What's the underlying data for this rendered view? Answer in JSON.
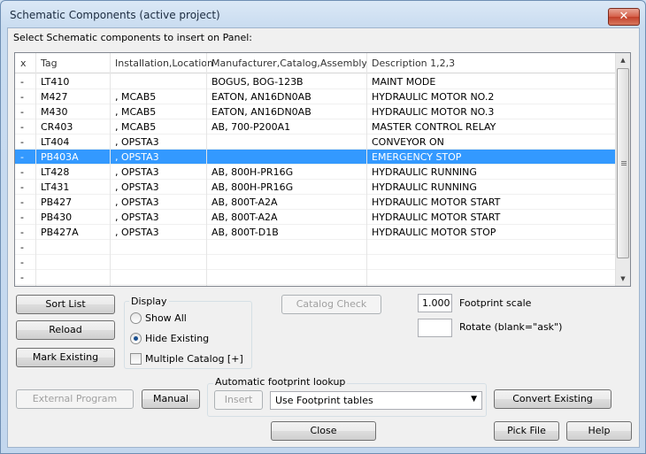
{
  "window": {
    "title": "Schematic Components (active project)",
    "close_glyph": "✕"
  },
  "prompt": "Select Schematic components to insert on Panel:",
  "table": {
    "headers": [
      "x",
      "Tag",
      "Installation,Location",
      "Manufacturer,Catalog,Assembly",
      "Description 1,2,3"
    ],
    "rows": [
      {
        "x": "-",
        "tag": "LT410",
        "loc": "",
        "mfr": "BOGUS, BOG-123B",
        "desc": "MAINT MODE"
      },
      {
        "x": "-",
        "tag": "M427",
        "loc": ", MCAB5",
        "mfr": "EATON, AN16DN0AB",
        "desc": "HYDRAULIC MOTOR NO.2"
      },
      {
        "x": "-",
        "tag": "M430",
        "loc": ", MCAB5",
        "mfr": "EATON, AN16DN0AB",
        "desc": "HYDRAULIC MOTOR NO.3"
      },
      {
        "x": "-",
        "tag": "CR403",
        "loc": ", MCAB5",
        "mfr": "AB, 700-P200A1",
        "desc": "MASTER CONTROL RELAY"
      },
      {
        "x": "-",
        "tag": "LT404",
        "loc": ", OPSTA3",
        "mfr": "",
        "desc": "CONVEYOR ON"
      },
      {
        "x": "-",
        "tag": "PB403A",
        "loc": ", OPSTA3",
        "mfr": "",
        "desc": "EMERGENCY STOP"
      },
      {
        "x": "-",
        "tag": "LT428",
        "loc": ", OPSTA3",
        "mfr": "AB, 800H-PR16G",
        "desc": "HYDRAULIC RUNNING"
      },
      {
        "x": "-",
        "tag": "LT431",
        "loc": ", OPSTA3",
        "mfr": "AB, 800H-PR16G",
        "desc": "HYDRAULIC RUNNING"
      },
      {
        "x": "-",
        "tag": "PB427",
        "loc": ", OPSTA3",
        "mfr": "AB, 800T-A2A",
        "desc": "HYDRAULIC MOTOR START"
      },
      {
        "x": "-",
        "tag": "PB430",
        "loc": ", OPSTA3",
        "mfr": "AB, 800T-A2A",
        "desc": "HYDRAULIC MOTOR START"
      },
      {
        "x": "-",
        "tag": "PB427A",
        "loc": ", OPSTA3",
        "mfr": "AB, 800T-D1B",
        "desc": "HYDRAULIC MOTOR STOP"
      },
      {
        "x": "-",
        "tag": "",
        "loc": "",
        "mfr": "",
        "desc": ""
      },
      {
        "x": "-",
        "tag": "",
        "loc": "",
        "mfr": "",
        "desc": ""
      },
      {
        "x": "-",
        "tag": "",
        "loc": "",
        "mfr": "",
        "desc": ""
      }
    ],
    "selected_index": 5,
    "selection_color": "#3399ff"
  },
  "buttons": {
    "sort_list": "Sort List",
    "reload": "Reload",
    "mark_existing": "Mark Existing",
    "catalog_check": "Catalog Check",
    "external_program": "External Program",
    "manual": "Manual",
    "insert": "Insert",
    "convert_existing": "Convert Existing",
    "close": "Close",
    "pick_file": "Pick File",
    "help": "Help"
  },
  "display": {
    "label": "Display",
    "show_all": "Show All",
    "hide_existing": "Hide Existing",
    "multiple_catalog": "Multiple Catalog [+]",
    "selected": "hide_existing",
    "multiple_catalog_checked": false
  },
  "footprint": {
    "scale_value": "1.000",
    "scale_label": "Footprint scale",
    "rotate_value": "",
    "rotate_label": "Rotate (blank=\"ask\")"
  },
  "lookup": {
    "label": "Automatic footprint lookup",
    "selected": "Use Footprint tables"
  },
  "icons": {
    "scroll_up": "▲",
    "scroll_down": "▼",
    "dropdown": "▼"
  }
}
